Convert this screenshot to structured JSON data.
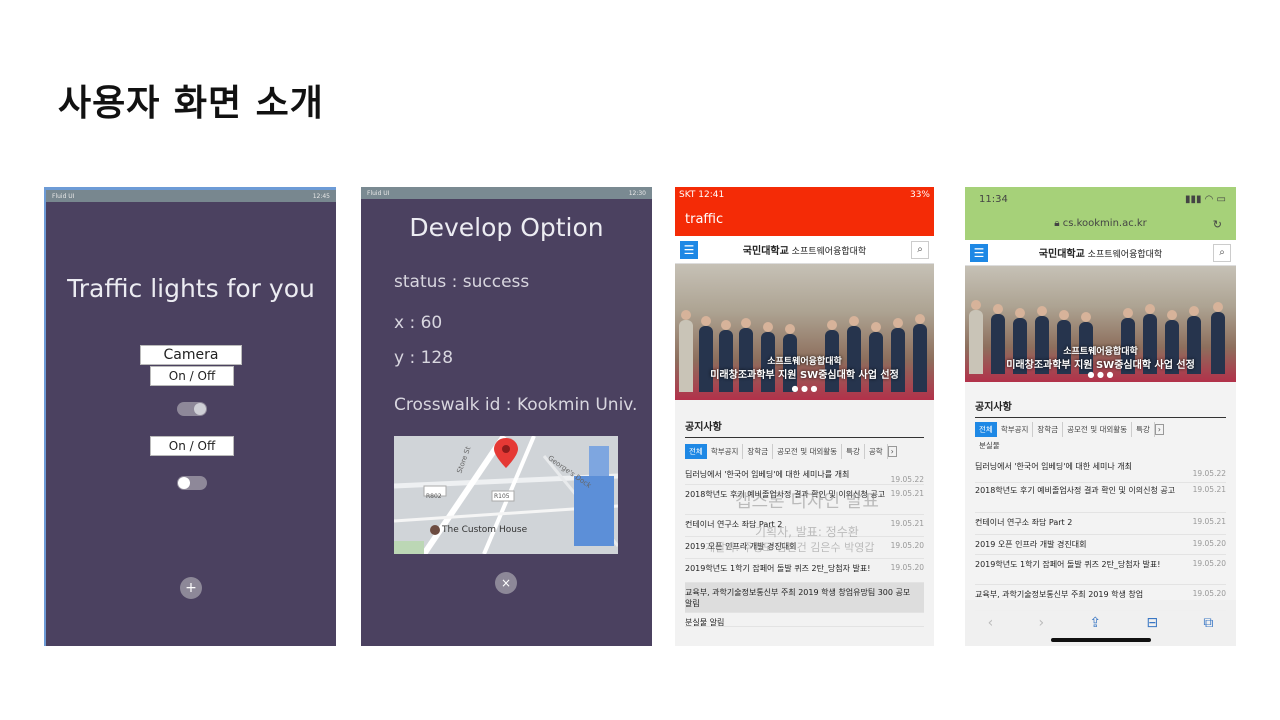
{
  "slide": {
    "title": "사용자 화면 소개"
  },
  "phone1": {
    "status_left": "Fluid UI",
    "status_right": "12:45",
    "title": "Traffic lights for you",
    "camera_label": "Camera",
    "toggle1_label": "On / Off",
    "toggle2_label": "On / Off",
    "fab": "+"
  },
  "phone2": {
    "status_left": "Fluid UI",
    "status_right": "12:30",
    "title": "Develop Option",
    "status": "status : success",
    "x": "x : 60",
    "y": "y : 128",
    "crosswalk": "Crosswalk id : Kookmin Univ.",
    "map": {
      "poi": "The Custom House",
      "roads": [
        "R802",
        "R105",
        "Store St",
        "George's Dock"
      ]
    },
    "fab": "×"
  },
  "phone3": {
    "status_left": "SKT 12:41",
    "status_right": "33%",
    "app_title": "traffic",
    "logo_main": "국민대학교",
    "logo_sub": "소프트웨어융합대학",
    "hero_line1": "소프트웨어융합대학",
    "hero_line2": "미래창조과학부 지원 SW중심대학 사업 선정",
    "notice_title": "공지사항",
    "tabs": [
      "전체",
      "학부공지",
      "장학금",
      "공모전 및 대외활동",
      "특강",
      "공학"
    ],
    "notices": [
      {
        "text": "딥러닝에서 '한국어 임베딩'에 대한 세미나를 개최",
        "date": "19.05.22"
      },
      {
        "text": "2018학년도 후기 예비졸업사정 결과 확인 및 이의신청 공고",
        "date": "19.05.21"
      },
      {
        "text": "컨테이너 연구소 좌담 Part 2",
        "date": "19.05.21"
      },
      {
        "text": "2019 오픈 인프라 개발 경진대회",
        "date": "19.05.20"
      },
      {
        "text": "2019학년도 1학기 잡페어 돌발 퀴즈 2탄_당첨자 발표!",
        "date": "19.05.20"
      },
      {
        "text": "교육부, 과학기술정보통신부 주최 2019 학생 창업유망팀 300 공모 알림",
        "date": ""
      },
      {
        "text": "분실물 알림",
        "date": ""
      }
    ],
    "overlay": [
      "캡스톤 디자인 발표",
      "기획자, 발표: 정수환",
      "개발자: 주형모 김신건 김은수 박영갑"
    ]
  },
  "phone4": {
    "time": "11:34",
    "url": "cs.kookmin.ac.kr",
    "logo_main": "국민대학교",
    "logo_sub": "소프트웨어융합대학",
    "hero_line1": "소프트웨어융합대학",
    "hero_line2": "미래창조과학부 지원 SW중심대학 사업 선정",
    "notice_title": "공지사항",
    "tabs": [
      "전체",
      "학부공지",
      "장학금",
      "공모전 및 대외활동",
      "특강"
    ],
    "tab_extra": "분실물",
    "notices": [
      {
        "text": "딥러닝에서 '한국어 임베딩'에 대한 세미나 개최",
        "date": "19.05.22"
      },
      {
        "text": "2018학년도 후기 예비졸업사정 결과 확인 및 이의신청 공고",
        "date": "19.05.21"
      },
      {
        "text": "컨테이너 연구소 좌담 Part 2",
        "date": "19.05.21"
      },
      {
        "text": "2019 오픈 인프라 개발 경진대회",
        "date": "19.05.20"
      },
      {
        "text": "2019학년도 1학기 잡페어 돌발 퀴즈 2탄_당첨자 발표!",
        "date": "19.05.20"
      },
      {
        "text": "교육부, 과학기술정보통신부 주최 2019 학생 창업",
        "date": "19.05.20"
      }
    ]
  }
}
